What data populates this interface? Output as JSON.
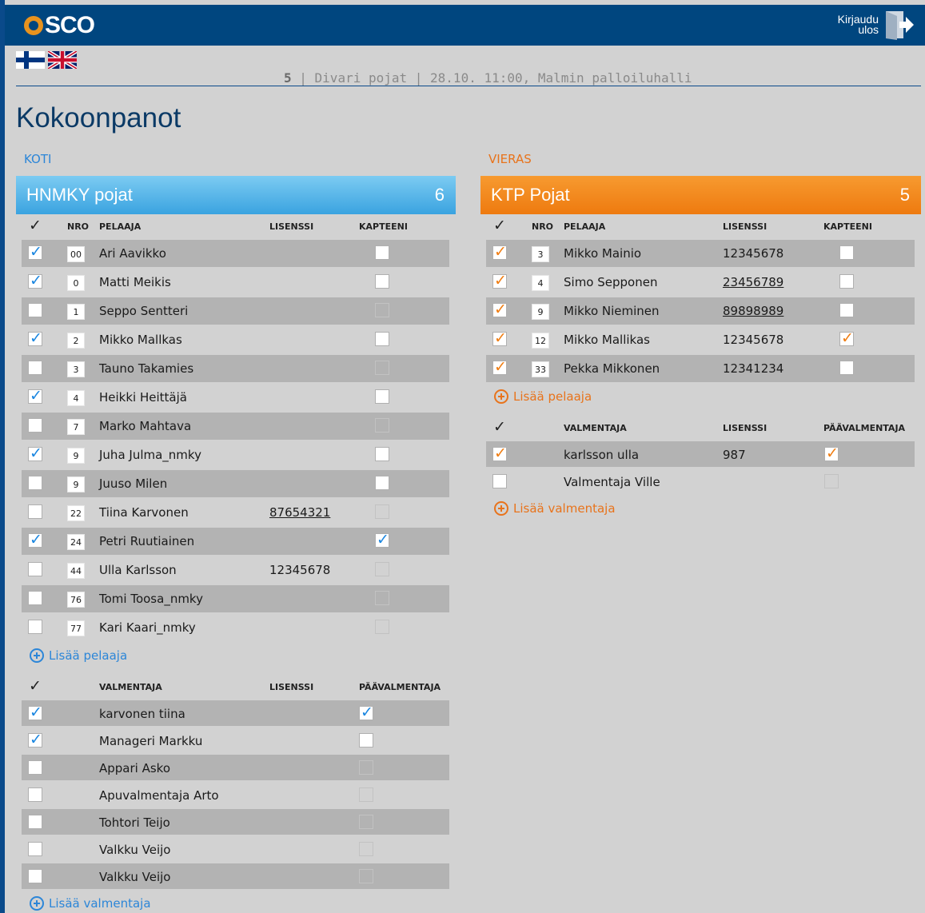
{
  "header": {
    "logo_text": "SCO",
    "logout_line1": "Kirjaudu",
    "logout_line2": "ulos"
  },
  "flags": [
    "Suomi",
    "English"
  ],
  "match": {
    "number": "5",
    "details": " | Divari pojat | 28.10. 11:00, Malmin palloiluhalli"
  },
  "page_title": "Kokoonpanot",
  "home": {
    "side_label": "KOTI",
    "team_name": "HNMKY pojat",
    "count": "6",
    "columns": {
      "check": "✓",
      "nro": "NRO",
      "player": "PELAAJA",
      "license": "LISENSSI",
      "captain": "KAPTEENI"
    },
    "players": [
      {
        "checked": true,
        "nro": "00",
        "name": "Ari Aavikko",
        "license": "",
        "captain": false,
        "captain_enabled": true
      },
      {
        "checked": true,
        "nro": "0",
        "name": "Matti Meikis",
        "license": "",
        "captain": false,
        "captain_enabled": true
      },
      {
        "checked": false,
        "nro": "1",
        "name": "Seppo Sentteri",
        "license": "",
        "captain": false,
        "captain_enabled": false
      },
      {
        "checked": true,
        "nro": "2",
        "name": "Mikko Mallkas",
        "license": "",
        "captain": false,
        "captain_enabled": true
      },
      {
        "checked": false,
        "nro": "3",
        "name": "Tauno Takamies",
        "license": "",
        "captain": false,
        "captain_enabled": false
      },
      {
        "checked": true,
        "nro": "4",
        "name": "Heikki Heittäjä",
        "license": "",
        "captain": false,
        "captain_enabled": true
      },
      {
        "checked": false,
        "nro": "7",
        "name": "Marko Mahtava",
        "license": "",
        "captain": false,
        "captain_enabled": false
      },
      {
        "checked": true,
        "nro": "9",
        "name": "Juha Julma_nmky",
        "license": "",
        "captain": false,
        "captain_enabled": true
      },
      {
        "checked": false,
        "nro": "9",
        "name": "Juuso Milen",
        "license": "",
        "captain": false,
        "captain_enabled": true
      },
      {
        "checked": false,
        "nro": "22",
        "name": "Tiina Karvonen",
        "license": "87654321",
        "license_link": true,
        "captain": false,
        "captain_enabled": false
      },
      {
        "checked": true,
        "nro": "24",
        "name": "Petri Ruutiainen",
        "license": "",
        "captain": true,
        "captain_enabled": true
      },
      {
        "checked": false,
        "nro": "44",
        "name": "Ulla Karlsson",
        "license": "12345678",
        "captain": false,
        "captain_enabled": false
      },
      {
        "checked": false,
        "nro": "76",
        "name": "Tomi Toosa_nmky",
        "license": "",
        "captain": false,
        "captain_enabled": false
      },
      {
        "checked": false,
        "nro": "77",
        "name": "Kari Kaari_nmky",
        "license": "",
        "captain": false,
        "captain_enabled": false
      }
    ],
    "add_player": "Lisää pelaaja",
    "coach_columns": {
      "check": "✓",
      "coach": "VALMENTAJA",
      "license": "LISENSSI",
      "head": "PÄÄVALMENTAJA"
    },
    "coaches": [
      {
        "checked": true,
        "name": "karvonen tiina",
        "license": "",
        "head": true,
        "head_enabled": true
      },
      {
        "checked": true,
        "name": "Manageri Markku",
        "license": "",
        "head": false,
        "head_enabled": true
      },
      {
        "checked": false,
        "name": "Appari Asko",
        "license": "",
        "head": false,
        "head_enabled": false
      },
      {
        "checked": false,
        "name": "Apuvalmentaja Arto",
        "license": "",
        "head": false,
        "head_enabled": false
      },
      {
        "checked": false,
        "name": "Tohtori Teijo",
        "license": "",
        "head": false,
        "head_enabled": false
      },
      {
        "checked": false,
        "name": "Valkku Veijo",
        "license": "",
        "head": false,
        "head_enabled": false
      },
      {
        "checked": false,
        "name": "Valkku Veijo",
        "license": "",
        "head": false,
        "head_enabled": false
      }
    ],
    "add_coach": "Lisää valmentaja"
  },
  "away": {
    "side_label": "VIERAS",
    "team_name": "KTP Pojat",
    "count": "5",
    "columns": {
      "check": "✓",
      "nro": "NRO",
      "player": "PELAAJA",
      "license": "LISENSSI",
      "captain": "KAPTEENI"
    },
    "players": [
      {
        "checked": true,
        "nro": "3",
        "name": "Mikko Mainio",
        "license": "12345678",
        "captain": false,
        "captain_enabled": true
      },
      {
        "checked": true,
        "nro": "4",
        "name": "Simo Sepponen",
        "license": "23456789",
        "license_link": true,
        "captain": false,
        "captain_enabled": true
      },
      {
        "checked": true,
        "nro": "9",
        "name": "Mikko Nieminen",
        "license": "89898989",
        "license_link": true,
        "captain": false,
        "captain_enabled": true
      },
      {
        "checked": true,
        "nro": "12",
        "name": "Mikko Mallikas",
        "license": "12345678",
        "captain": true,
        "captain_enabled": true
      },
      {
        "checked": true,
        "nro": "33",
        "name": "Pekka Mikkonen",
        "license": "12341234",
        "captain": false,
        "captain_enabled": true
      }
    ],
    "add_player": "Lisää pelaaja",
    "coach_columns": {
      "check": "✓",
      "coach": "VALMENTAJA",
      "license": "LISENSSI",
      "head": "PÄÄVALMENTAJA"
    },
    "coaches": [
      {
        "checked": true,
        "name": "karlsson ulla",
        "license": "987",
        "head": true,
        "head_enabled": true
      },
      {
        "checked": false,
        "name": "Valmentaja Ville",
        "license": "",
        "head": false,
        "head_enabled": false
      }
    ],
    "add_coach": "Lisää valmentaja"
  }
}
